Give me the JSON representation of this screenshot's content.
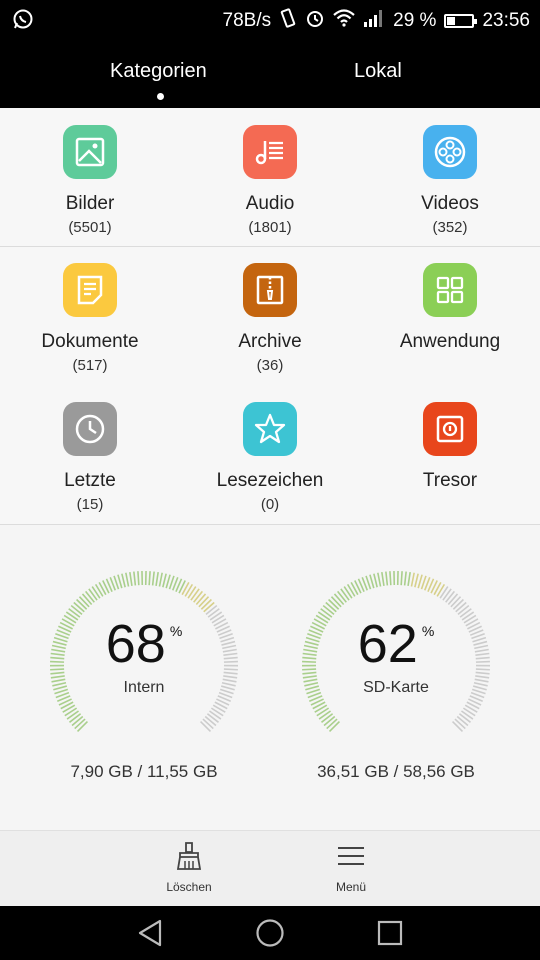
{
  "status_bar": {
    "speed": "78B/s",
    "battery_percent": "29 %",
    "time": "23:56",
    "battery_level": 0.29,
    "icons": [
      "whatsapp-icon",
      "vibrate-icon",
      "alarm-icon",
      "wifi-icon",
      "signal-icon",
      "battery-icon"
    ]
  },
  "tabs": [
    {
      "label": "Kategorien",
      "active": true
    },
    {
      "label": "Lokal",
      "active": false
    }
  ],
  "categories": [
    {
      "label": "Bilder",
      "count": "(5501)",
      "color": "#5ecb9a",
      "icon": "image-icon"
    },
    {
      "label": "Audio",
      "count": "(1801)",
      "color": "#f46a53",
      "icon": "audio-icon"
    },
    {
      "label": "Videos",
      "count": "(352)",
      "color": "#48b1ee",
      "icon": "video-icon"
    },
    {
      "label": "Dokumente",
      "count": "(517)",
      "color": "#fbc93f",
      "icon": "document-icon"
    },
    {
      "label": "Archive",
      "count": "(36)",
      "color": "#c4650f",
      "icon": "archive-icon"
    },
    {
      "label": "Anwendung",
      "count": "",
      "color": "#8bcf56",
      "icon": "apps-icon"
    },
    {
      "label": "Letzte",
      "count": "(15)",
      "color": "#9a9a9a",
      "icon": "clock-icon"
    },
    {
      "label": "Lesezeichen",
      "count": "(0)",
      "color": "#3dc4d3",
      "icon": "star-icon"
    },
    {
      "label": "Tresor",
      "count": "",
      "color": "#e8461c",
      "icon": "safe-icon"
    }
  ],
  "storage": [
    {
      "name": "Intern",
      "percent": "68",
      "percent_sign": "%",
      "size": "7,90 GB / 11,55 GB",
      "level": 0.68
    },
    {
      "name": "SD-Karte",
      "percent": "62",
      "percent_sign": "%",
      "size": "36,51 GB / 58,56 GB",
      "level": 0.62
    }
  ],
  "toolbar": {
    "clean_label": "Löschen",
    "menu_label": "Menü"
  },
  "colors": {
    "gauge_used": "#a9cf8c",
    "gauge_warn": "#d7d08a",
    "gauge_free": "#cccccc"
  }
}
